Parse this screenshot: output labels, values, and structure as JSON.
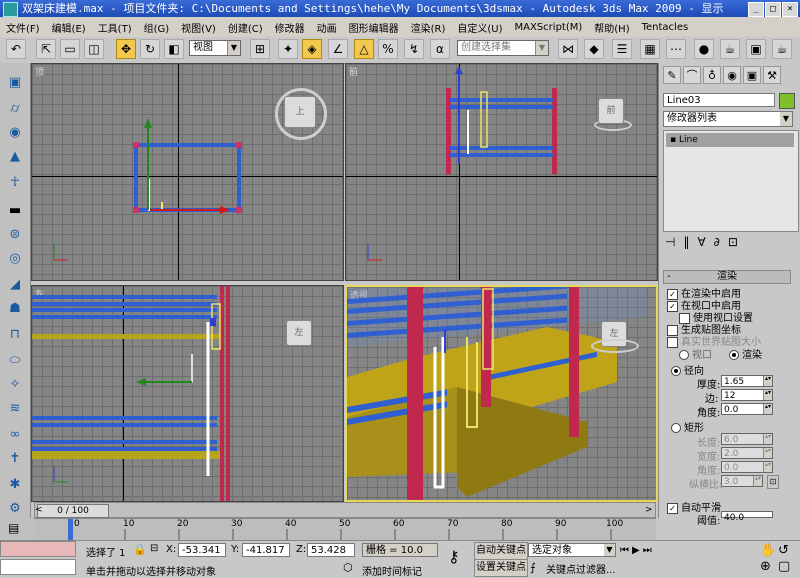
{
  "window": {
    "title": "双架床建模.max   - 项目文件夹: C:\\Documents and Settings\\hehe\\My Documents\\3dsmax   - Autodesk 3ds Max  2009  - 显示",
    "min": "_",
    "max": "□",
    "close": "×"
  },
  "menu": [
    "文件(F)",
    "编辑(E)",
    "工具(T)",
    "组(G)",
    "视图(V)",
    "创建(C)",
    "修改器",
    "动画",
    "图形编辑器",
    "渲染(R)",
    "自定义(U)",
    "MAXScript(M)",
    "帮助(H)",
    "Tentacles"
  ],
  "toolbar": {
    "view_combo": "视图",
    "selection_set_placeholder": "创建选择集",
    "icons": [
      "undo-icon",
      "select-icon",
      "rect-select-icon",
      "window-crossing-icon",
      "select-move-icon",
      "select-rotate-icon",
      "select-scale-icon",
      "snap-icon",
      "angle-snap-icon",
      "percent-snap-icon",
      "spinner-snap-icon",
      "edit-named-sel-icon",
      "mirror-icon",
      "align-icon",
      "layer-icon",
      "curve-editor-icon",
      "schematic-icon",
      "material-editor-icon",
      "render-setup-icon",
      "render-frame-icon",
      "quick-render-icon"
    ]
  },
  "viewports": {
    "top": {
      "label": "顶"
    },
    "front": {
      "label": "前"
    },
    "left": {
      "label": "左"
    },
    "persp": {
      "label": "透视"
    }
  },
  "panel": {
    "object_name": "Line03",
    "modifier_list": "修改器列表",
    "stack_item": "Line",
    "rollout_title": "渲染",
    "render_enable_renderer": "在渲染中启用",
    "render_enable_viewport": "在视口中启用",
    "use_viewport_settings": "使用视口设置",
    "gen_mapping": "生成贴图坐标",
    "real_world": "真实世界贴图大小",
    "viewport_opt": "视口",
    "render_opt": "渲染",
    "radial": "径向",
    "thickness_label": "厚度:",
    "thickness": "1.65",
    "sides_label": "边:",
    "sides": "12",
    "angle_label": "角度:",
    "angle": "0.0",
    "rect": "矩形",
    "length_label": "长度:",
    "length": "6.0",
    "width_label": "宽度:",
    "width": "2.0",
    "angle2_label": "角度:",
    "angle2": "0.0",
    "aspect_label": "纵横比:",
    "aspect": "3.0",
    "auto_smooth": "自动平滑",
    "threshold_label": "阈值:",
    "threshold": "40.0"
  },
  "timeline": {
    "frame": "0 / 100",
    "ticks": [
      "0",
      "10",
      "20",
      "30",
      "40",
      "50",
      "60",
      "70",
      "80",
      "90",
      "100"
    ]
  },
  "status": {
    "selected": "选择了 1",
    "x_label": "X:",
    "x": "-53.341",
    "y_label": "Y:",
    "y": "-41.817",
    "z_label": "Z:",
    "z": "53.428",
    "grid": "栅格 = 10.0",
    "auto_key": "自动关键点",
    "set_key": "设置关键点",
    "selected_obj": "选定对象",
    "key_filter": "关键点过滤器...",
    "prompt": "单击并拖动以选择并移动对象",
    "add_time_tag": "添加时间标记"
  }
}
